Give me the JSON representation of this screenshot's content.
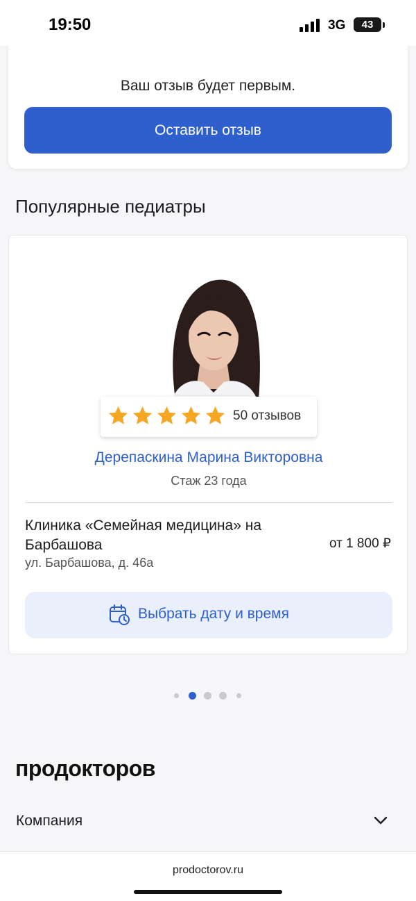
{
  "status_bar": {
    "time": "19:50",
    "network": "3G",
    "battery": "43",
    "battery_level_percent": 43
  },
  "review_section": {
    "text": "Ваш отзыв будет первым.",
    "button_label": "Оставить отзыв"
  },
  "popular": {
    "title": "Популярные педиатры"
  },
  "doctor": {
    "rating_stars": 5,
    "reviews_count": "50 отзывов",
    "name": "Дерепаскина Марина Викторовна",
    "experience": "Стаж 23 года",
    "clinic_name": "Клиника «Семейная медицина» на Барбашова",
    "address": "ул. Барбашова, д. 46а",
    "price": "от 1 800 ₽",
    "choose_time_label": "Выбрать дату и время"
  },
  "pagination": {
    "total": 5,
    "active_index": 1
  },
  "footer": {
    "logo": "продокторов",
    "company_label": "Компания"
  },
  "browser": {
    "url": "prodoctorov.ru"
  },
  "colors": {
    "accent": "#2f5fcc",
    "star": "#f5a623",
    "button_light": "#eaf0fb"
  }
}
